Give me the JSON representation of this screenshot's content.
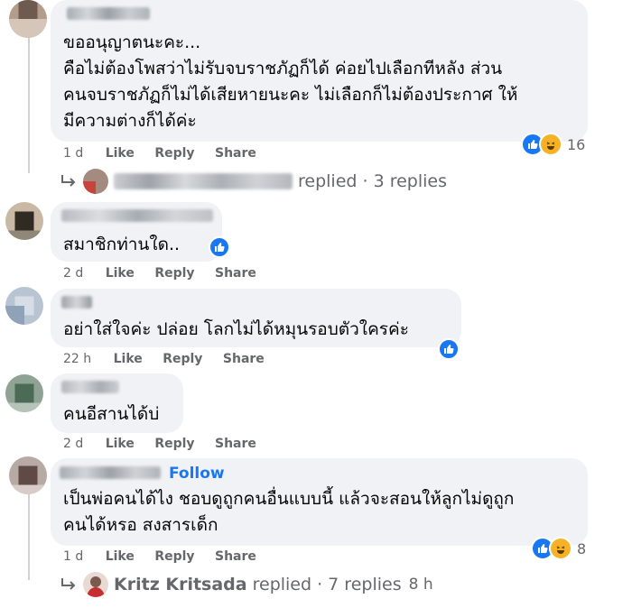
{
  "comments": [
    {
      "lines": [
        "ขออนุญาตนะคะ...",
        "คือไม่ต้องโพสว่าไม่รับจบราชภัฏก็ได้ ค่อยไปเลือกทีหลัง ส่วน",
        "คนจบราชภัฏก็ไม่ได้เสียหายนะคะ ไม่เลือกก็ไม่ต้องประกาศ ให้",
        "มีความต่างก็ได้ค่ะ"
      ],
      "time": "1 d",
      "like": "Like",
      "reply": "Reply",
      "share": "Share",
      "reaction_count": "16",
      "replies_text": "replied · 3 replies"
    },
    {
      "lines": [
        "สมาชิกท่านใด.."
      ],
      "time": "2 d",
      "like": "Like",
      "reply": "Reply",
      "share": "Share"
    },
    {
      "lines": [
        "อย่าใส่ใจค่ะ ปล่อย โลกไม่ได้หมุนรอบตัวใครค่ะ"
      ],
      "time": "22 h",
      "like": "Like",
      "reply": "Reply",
      "share": "Share"
    },
    {
      "lines": [
        "คนอีสานได้บ่"
      ],
      "time": "2 d",
      "like": "Like",
      "reply": "Reply",
      "share": "Share"
    },
    {
      "follow": "Follow",
      "lines": [
        "เป็นพ่อคนได้ไง ชอบดูถูกคนอื่นแบบนี้ แล้วจะสอนให้ลูกไม่ดูถูก",
        "คนได้หรอ สงสารเด็ก"
      ],
      "time": "1 d",
      "like": "Like",
      "reply": "Reply",
      "share": "Share",
      "reaction_count": "8",
      "reply_author": "Kritz Kritsada",
      "replies_text": "replied · 7 replies",
      "replies_time": "8 h"
    }
  ],
  "icons": {
    "reply_arrow": "reply-arrow-icon",
    "like": "like-reaction-icon",
    "haha": "haha-reaction-icon",
    "badge": "top-fan-badge-icon"
  },
  "colors": {
    "accent": "#1877f2",
    "bubble": "#f0f2f5",
    "meta": "#65676b",
    "haha": "#f7b125"
  }
}
